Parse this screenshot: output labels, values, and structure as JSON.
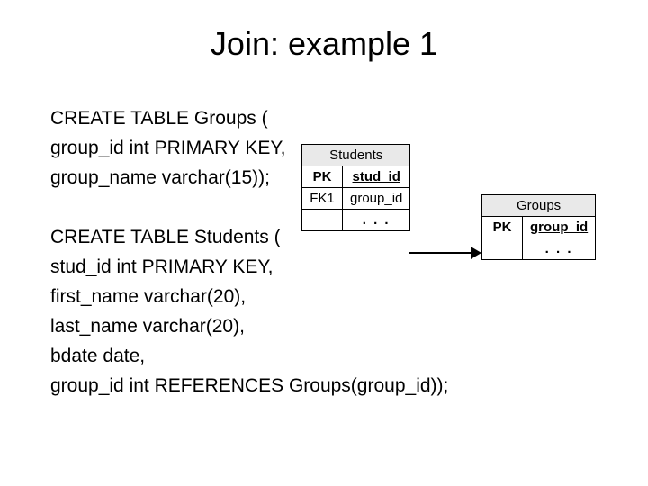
{
  "title": "Join: example 1",
  "sql": {
    "l1": "CREATE TABLE Groups (",
    "l2": "group_id int PRIMARY KEY,",
    "l3": "group_name varchar(15));",
    "l4": "CREATE TABLE Students (",
    "l5": "stud_id int PRIMARY KEY,",
    "l6": "first_name varchar(20),",
    "l7": "last_name varchar(20),",
    "l8": "bdate date,",
    "l9": "group_id int REFERENCES Groups(group_id));"
  },
  "diagram": {
    "students": {
      "name": "Students",
      "r1k": "PK",
      "r1c": "stud_id",
      "r2k": "FK1",
      "r2c": "group_id",
      "r3c": ". . ."
    },
    "groups": {
      "name": "Groups",
      "r1k": "PK",
      "r1c": "group_id",
      "r2c": ". . ."
    }
  }
}
